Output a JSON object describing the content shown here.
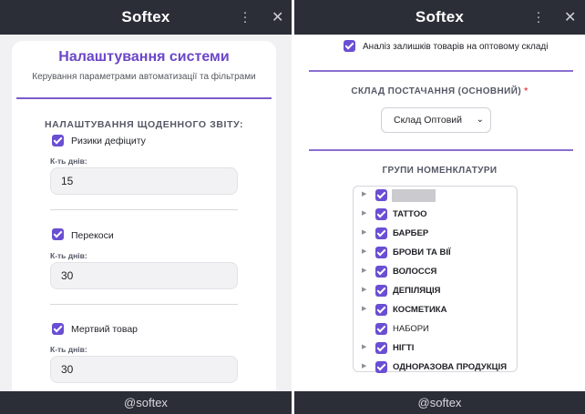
{
  "colors": {
    "accent": "#6a4ed3",
    "title": "#6b46c8",
    "bar": "#2c2e37"
  },
  "left": {
    "app_title": "Softex",
    "footer": "@softex",
    "card_title": "Налаштування системи",
    "card_subtitle": "Керування параметрами автоматизації та фільтрами",
    "section_title": "НАЛАШТУВАННЯ ЩОДЕННОГО ЗВІТУ:",
    "days_label": "К-ть днів:",
    "items": [
      {
        "label": "Ризики дефіциту",
        "days": "15",
        "checked": true
      },
      {
        "label": "Перекоси",
        "days": "30",
        "checked": true
      },
      {
        "label": "Мертвий товар",
        "days": "30",
        "checked": true
      }
    ]
  },
  "right": {
    "app_title": "Softex",
    "footer": "@softex",
    "stock_check_label": "Аналіз залишків товарів на оптовому складі",
    "supply_title": "СКЛАД ПОСТАЧАННЯ (ОСНОВНИЙ)",
    "required_mark": "*",
    "supply_value": "Склад Оптовий",
    "groups_title": "ГРУПИ НОМЕНКЛАТУРИ",
    "groups": [
      {
        "label": "",
        "expandable": true
      },
      {
        "label": "TATTOO",
        "expandable": true
      },
      {
        "label": "БАРБЕР",
        "expandable": true
      },
      {
        "label": "БРОВИ ТА ВІЇ",
        "expandable": true
      },
      {
        "label": "ВОЛОССЯ",
        "expandable": true
      },
      {
        "label": "ДЕПІЛЯЦІЯ",
        "expandable": true
      },
      {
        "label": "КОСМЕТИКА",
        "expandable": true
      },
      {
        "label": "НАБОРИ",
        "expandable": false
      },
      {
        "label": "НІГТІ",
        "expandable": true
      },
      {
        "label": "ОДНОРАЗОВА ПРОДУКЦІЯ",
        "expandable": true
      }
    ]
  }
}
